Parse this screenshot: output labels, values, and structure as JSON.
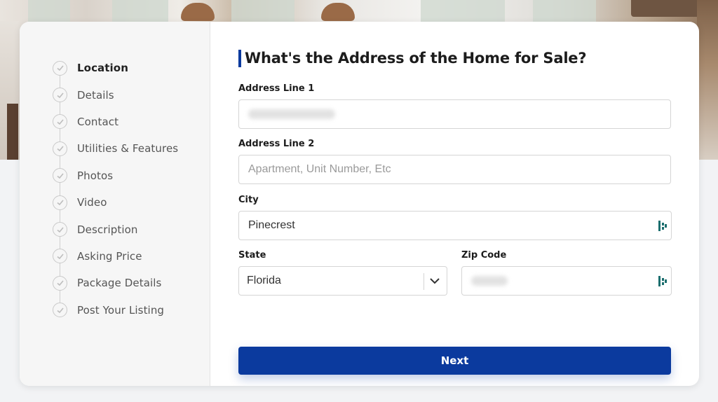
{
  "steps": [
    {
      "label": "Location",
      "active": true
    },
    {
      "label": "Details"
    },
    {
      "label": "Contact"
    },
    {
      "label": "Utilities & Features"
    },
    {
      "label": "Photos"
    },
    {
      "label": "Video"
    },
    {
      "label": "Description"
    },
    {
      "label": "Asking Price"
    },
    {
      "label": "Package Details"
    },
    {
      "label": "Post Your Listing"
    }
  ],
  "form": {
    "title": "What's the Address of the Home for Sale?",
    "address1": {
      "label": "Address Line 1",
      "value": ""
    },
    "address2": {
      "label": "Address Line 2",
      "placeholder": "Apartment, Unit Number, Etc"
    },
    "city": {
      "label": "City",
      "value": "Pinecrest"
    },
    "state": {
      "label": "State",
      "value": "Florida"
    },
    "zip": {
      "label": "Zip Code",
      "value": ""
    },
    "next_label": "Next"
  },
  "colors": {
    "accent": "#0b3a9e",
    "fill_icon": "#1b6e6e"
  }
}
